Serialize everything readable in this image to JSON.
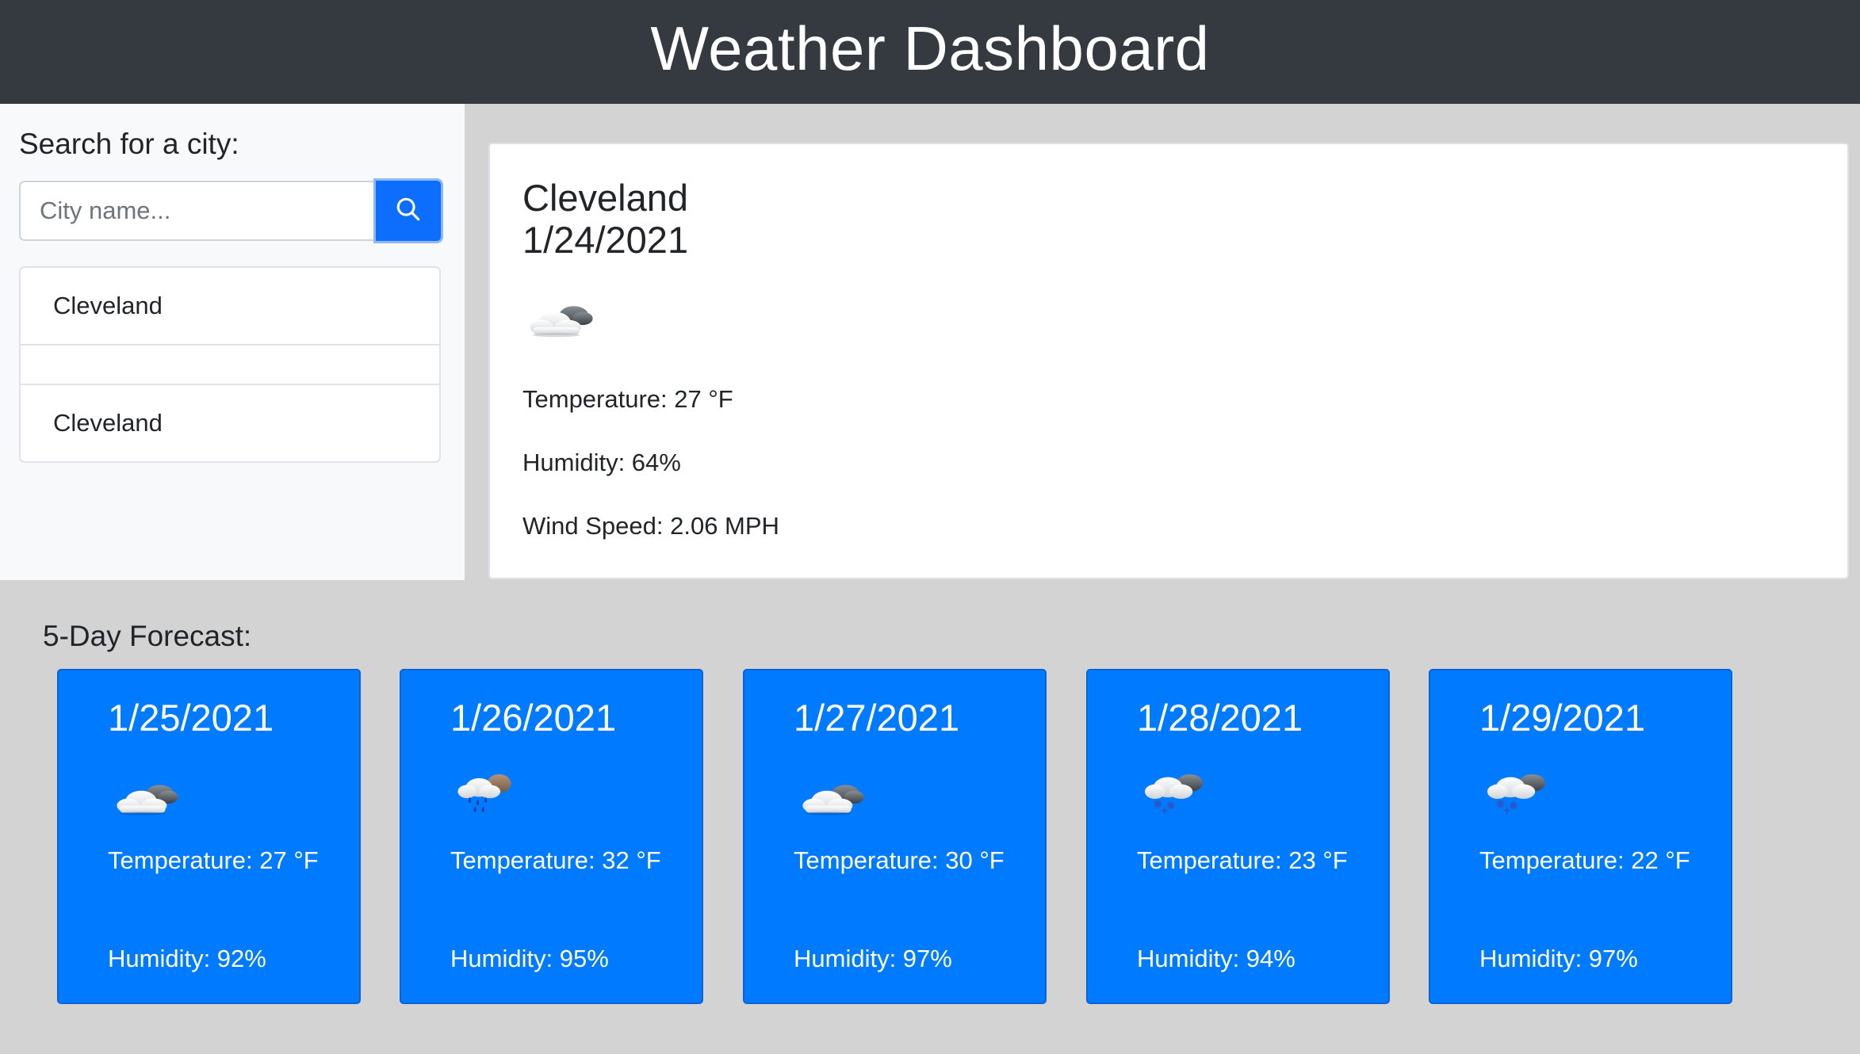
{
  "header": {
    "title": "Weather Dashboard"
  },
  "search": {
    "label": "Search for a city:",
    "placeholder": "City name...",
    "button_icon": "search-icon"
  },
  "history": {
    "items": [
      {
        "label": "Cleveland"
      },
      {
        "label": ""
      },
      {
        "label": "Cleveland"
      }
    ]
  },
  "current": {
    "city": "Cleveland",
    "date": "1/24/2021",
    "icon": "cloudy-icon",
    "temperature": "Temperature: 27 °F",
    "humidity": "Humidity: 64%",
    "wind": "Wind Speed: 2.06 MPH"
  },
  "forecast": {
    "title": "5-Day Forecast:",
    "days": [
      {
        "date": "1/25/2021",
        "icon": "cloudy-icon",
        "temperature": "Temperature: 27 °F",
        "humidity": "Humidity: 92%"
      },
      {
        "date": "1/26/2021",
        "icon": "rain-icon",
        "temperature": "Temperature: 32 °F",
        "humidity": "Humidity: 95%"
      },
      {
        "date": "1/27/2021",
        "icon": "cloudy-icon",
        "temperature": "Temperature: 30 °F",
        "humidity": "Humidity: 97%"
      },
      {
        "date": "1/28/2021",
        "icon": "snow-icon",
        "temperature": "Temperature: 23 °F",
        "humidity": "Humidity: 94%"
      },
      {
        "date": "1/29/2021",
        "icon": "snow-icon",
        "temperature": "Temperature: 22 °F",
        "humidity": "Humidity: 97%"
      }
    ]
  },
  "colors": {
    "header_bg": "#343a40",
    "accent": "#007bff",
    "page_bg": "#d3d3d3"
  }
}
